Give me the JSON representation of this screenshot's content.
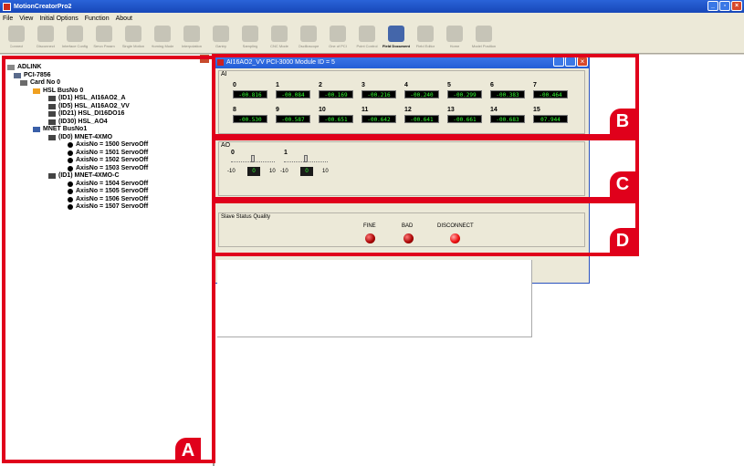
{
  "window": {
    "title": "MotionCreatorPro2"
  },
  "menu": [
    "File",
    "View",
    "Initial Options",
    "Function",
    "About"
  ],
  "toolbar": [
    {
      "label": "Connect",
      "icon": "hand-icon"
    },
    {
      "label": "Disconnect",
      "icon": "hand-icon"
    },
    {
      "label": "Interface Config",
      "icon": "stack-icon"
    },
    {
      "label": "Servo Param",
      "icon": "stack-icon"
    },
    {
      "label": "Single Motion",
      "icon": "chart-icon"
    },
    {
      "label": "Homing Mode",
      "icon": "home-icon"
    },
    {
      "label": "Interpolation",
      "icon": "axis-icon"
    },
    {
      "label": "Gantry",
      "icon": "gantry-icon"
    },
    {
      "label": "Sampling",
      "icon": "plug-icon"
    },
    {
      "label": "CNC Mode",
      "icon": "cnc-icon"
    },
    {
      "label": "Oscilloscope",
      "icon": "scope-icon"
    },
    {
      "label": "One of PCI",
      "icon": "board-icon"
    },
    {
      "label": "Point Control",
      "icon": "hand-icon"
    },
    {
      "label": "Field Document",
      "icon": "field-icon",
      "active": true
    },
    {
      "label": "Field Editor",
      "icon": "editor-icon"
    },
    {
      "label": "Home",
      "icon": "circle-icon"
    },
    {
      "label": "Model Position",
      "icon": "block-icon"
    }
  ],
  "tree": {
    "root": "ADLINK",
    "pci": "PCI-7856",
    "card": "Card No 0",
    "hsl_bus": "HSL BusNo 0",
    "hsl_modules": [
      "(ID1) HSL_AI16AO2_A",
      "(ID5) HSL_AI16AO2_VV",
      "(ID21) HSL_DI16DO16",
      "(ID30) HSL_AO4"
    ],
    "mnet_bus": "MNET BusNo1",
    "mnet_groups": [
      {
        "label": "(ID0) MNET-4XMO",
        "axes": [
          "AxisNo = 1500 ServoOff",
          "AxisNo = 1501 ServoOff",
          "AxisNo = 1502 ServoOff",
          "AxisNo = 1503 ServoOff"
        ]
      },
      {
        "label": "(ID1) MNET-4XMO-C",
        "axes": [
          "AxisNo = 1504 ServoOff",
          "AxisNo = 1505 ServoOff",
          "AxisNo = 1506 ServoOff",
          "AxisNo = 1507 ServoOff"
        ]
      }
    ]
  },
  "module_window": {
    "title": "AI16AO2_VV PCI-3000 Module ID = 5",
    "ai_label": "AI",
    "ai_channels": [
      {
        "ch": "0",
        "value": "-00.816"
      },
      {
        "ch": "1",
        "value": "-00.084"
      },
      {
        "ch": "2",
        "value": "-00.169"
      },
      {
        "ch": "3",
        "value": "-00.216"
      },
      {
        "ch": "4",
        "value": "-00.240"
      },
      {
        "ch": "5",
        "value": "-00.299"
      },
      {
        "ch": "6",
        "value": "-00.383"
      },
      {
        "ch": "7",
        "value": "-00.464"
      },
      {
        "ch": "8",
        "value": "-00.530"
      },
      {
        "ch": "9",
        "value": "-00.587"
      },
      {
        "ch": "10",
        "value": "-00.651"
      },
      {
        "ch": "11",
        "value": "-00.642"
      },
      {
        "ch": "12",
        "value": "-00.641"
      },
      {
        "ch": "13",
        "value": "-00.661"
      },
      {
        "ch": "14",
        "value": "-00.683"
      },
      {
        "ch": "15",
        "value": "07.944"
      }
    ],
    "ao_label": "AO",
    "ao_channels": [
      {
        "ch": "0",
        "min": "-10",
        "max": "10",
        "value": "0"
      },
      {
        "ch": "1",
        "min": "-10",
        "max": "10",
        "value": "0"
      }
    ],
    "slave_label": "Slave Status Quality",
    "status": [
      {
        "label": "FINE"
      },
      {
        "label": "BAD"
      },
      {
        "label": "DISCONNECT"
      }
    ]
  },
  "annotations": [
    "A",
    "B",
    "C",
    "D"
  ],
  "colors": {
    "annotation": "#e0001b",
    "ai_text": "#33ff33",
    "led": "#d00000"
  }
}
